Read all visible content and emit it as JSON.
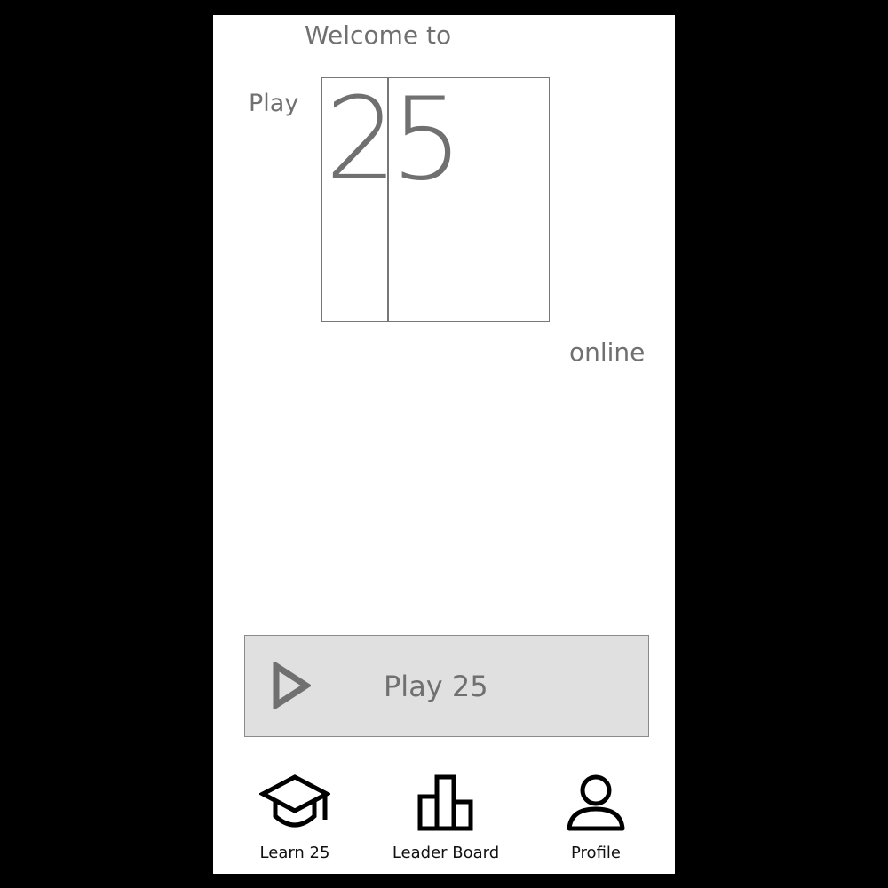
{
  "welcome": {
    "line1": "Welcome to",
    "play_word": "Play",
    "logo_digit_1": "2",
    "logo_digit_2": "5",
    "suffix": "online"
  },
  "play_button": {
    "label": "Play 25",
    "icon": "play-triangle-icon"
  },
  "bottom_nav": [
    {
      "label": "Learn 25",
      "icon": "graduation-cap-icon"
    },
    {
      "label": "Leader Board",
      "icon": "bar-chart-icon"
    },
    {
      "label": "Profile",
      "icon": "person-icon"
    }
  ],
  "colors": {
    "background": "#000000",
    "screen": "#ffffff",
    "text_gray": "#707070",
    "button_fill": "#e0e0e0"
  }
}
